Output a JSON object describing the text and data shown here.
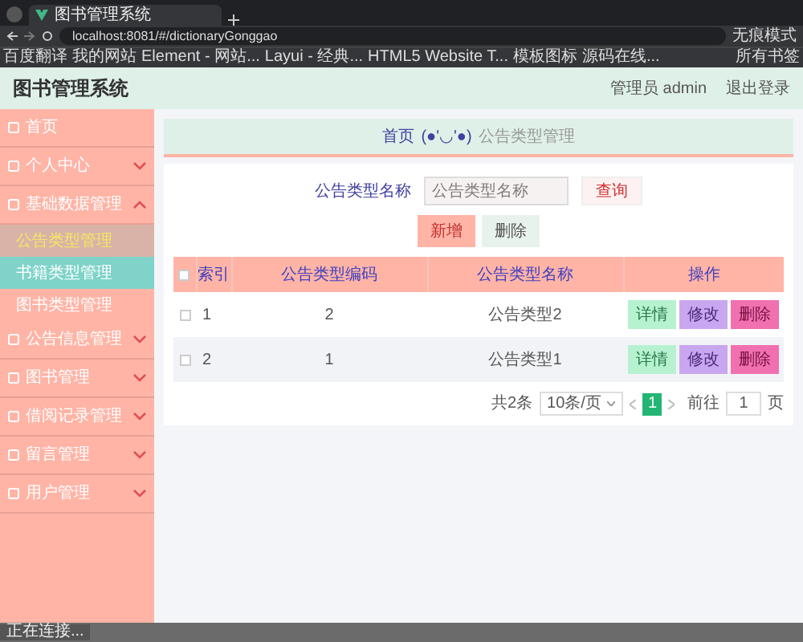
{
  "browser": {
    "tab_title": "图书管理系统",
    "url": "localhost:8081/#/dictionaryGonggao",
    "profile": "无痕模式",
    "bookmarks": [
      "百度翻译",
      "我的网站",
      "Element - 网站...",
      "Layui - 经典...",
      "HTML5 Website T...",
      "模板图标",
      "源码在线..."
    ],
    "all_bookmarks": "所有书签"
  },
  "header": {
    "title": "图书管理系统",
    "user": "管理员 admin",
    "logout": "退出登录"
  },
  "sidebar": {
    "items": [
      {
        "label": "首页"
      },
      {
        "label": "个人中心",
        "expanded": false
      },
      {
        "label": "基础数据管理",
        "expanded": true,
        "children": [
          {
            "label": "公告类型管理",
            "selected": true,
            "hovered": false
          },
          {
            "label": "书籍类型管理",
            "selected": false,
            "hovered": true
          },
          {
            "label": "图书类型管理",
            "selected": false,
            "hovered": false
          }
        ]
      },
      {
        "label": "公告信息管理",
        "expanded": false
      },
      {
        "label": "图书管理",
        "expanded": false
      },
      {
        "label": "借阅记录管理",
        "expanded": false
      },
      {
        "label": "留言管理",
        "expanded": false
      },
      {
        "label": "用户管理",
        "expanded": false
      }
    ]
  },
  "breadcrumb": [
    "首页",
    "(●'◡'●)",
    "公告类型管理"
  ],
  "search": {
    "label": "公告类型名称",
    "placeholder": "公告类型名称",
    "button": "查询"
  },
  "actions": [
    "新增",
    "删除"
  ],
  "table": {
    "all_checked": false,
    "columns": [
      "索引",
      "公告类型编码",
      "公告类型名称",
      "操作"
    ],
    "rows": [
      {
        "checked": false,
        "cells": [
          "1",
          "2",
          "公告类型2"
        ],
        "buttons": [
          "详情",
          "修改",
          "删除"
        ]
      },
      {
        "checked": false,
        "cells": [
          "2",
          "1",
          "公告类型1"
        ],
        "buttons": [
          "详情",
          "修改",
          "删除"
        ]
      }
    ]
  },
  "pagination": {
    "total": "共2条",
    "page_size": "10条/页",
    "pages": [
      {
        "label": "1",
        "selected": true
      }
    ],
    "goto": "前往",
    "goto_value": "1",
    "page_unit": "页"
  },
  "status_bar": "正在连接..."
}
